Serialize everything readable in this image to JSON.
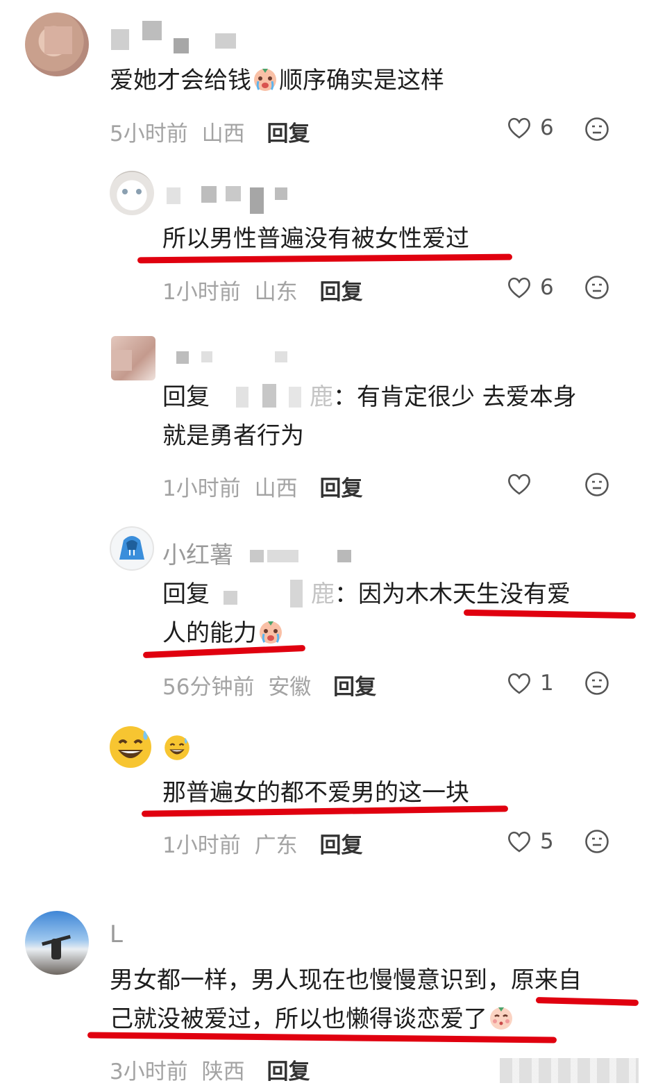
{
  "comments": [
    {
      "user": "",
      "text": "爱她才会给钱",
      "text_after_emoji": "顺序确实是这样",
      "time": "5小时前",
      "location": "山西",
      "reply_label": "回复",
      "likes": "6"
    },
    {
      "user": "",
      "text": "所以男性普遍没有被女性爱过",
      "time": "1小时前",
      "location": "山东",
      "reply_label": "回复",
      "likes": "6"
    },
    {
      "user": "",
      "reply_prefix": "回复",
      "reply_target_tail": "鹿",
      "text_line1": "：有肯定很少 去爱本身",
      "text_line2": "就是勇者行为",
      "time": "1小时前",
      "location": "山西",
      "reply_label": "回复",
      "likes": ""
    },
    {
      "user": "小红薯",
      "reply_prefix": "回复",
      "reply_target_tail": "鹿",
      "text_line1": "：因为木木天生没有爱",
      "text_line2": "人的能力",
      "time": "56分钟前",
      "location": "安徽",
      "reply_label": "回复",
      "likes": "1"
    },
    {
      "user": "",
      "text": "那普遍女的都不爱男的这一块",
      "time": "1小时前",
      "location": "广东",
      "reply_label": "回复",
      "likes": "5"
    },
    {
      "user": "L",
      "text_line1": "男女都一样，男人现在也慢慢意识到，原来自",
      "text_line2": "己就没被爱过，所以也懒得谈恋爱了",
      "time": "3小时前",
      "location": "陕西",
      "reply_label": "回复",
      "likes": ""
    }
  ],
  "colors": {
    "underline": "#e0000f",
    "meta_gray": "#a3a3a3",
    "text": "#1d1d1d"
  },
  "icons": [
    "heart-icon",
    "dislike-face-icon",
    "crying-emoji-icon",
    "sweat-smile-emoji-icon",
    "blush-emoji-icon"
  ]
}
